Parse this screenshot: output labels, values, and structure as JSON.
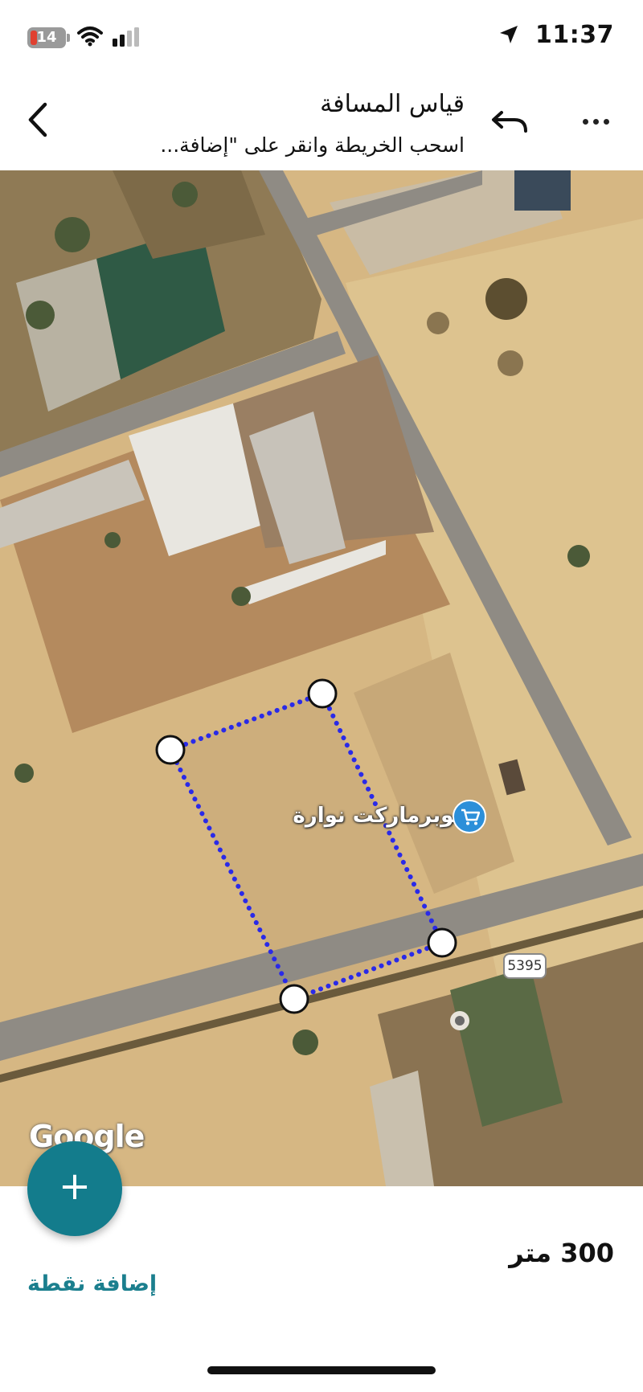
{
  "status_bar": {
    "time": "11:37",
    "battery": "14",
    "icons": [
      "location-arrow-icon",
      "wifi-icon",
      "cellular-signal-icon",
      "battery-icon"
    ]
  },
  "nav": {
    "title": "قياس المسافة",
    "subtitle": "اسحب الخريطة وانقر على \"إضافة...",
    "icons": [
      "chevron-left-icon",
      "undo-icon",
      "more-horizontal-icon"
    ]
  },
  "map": {
    "watermark": "Google",
    "road_label": "5395",
    "poi_name": "سوبرماركت نوارة",
    "poi_icon": "shopping-cart-icon",
    "measure_line_color": "#2a2ae8",
    "point_count": 4
  },
  "bottom": {
    "add_button_icon": "plus-icon",
    "add_point_label": "إضافة نقطة",
    "distance": "300 متر",
    "accent_color": "#137c8c"
  }
}
